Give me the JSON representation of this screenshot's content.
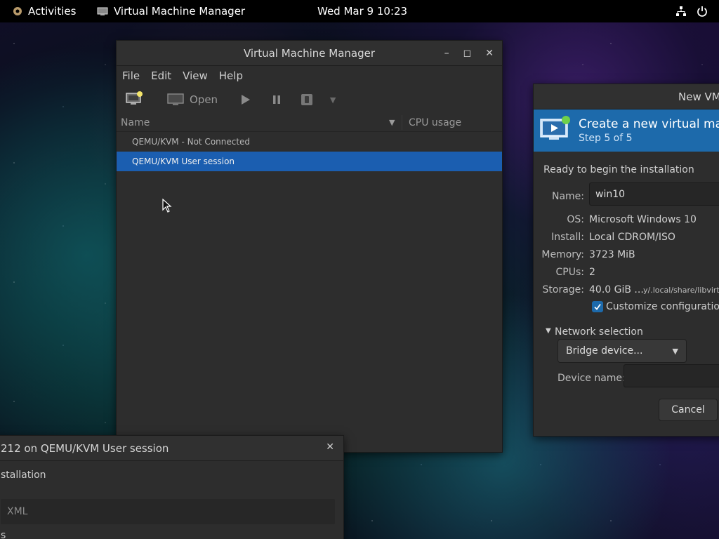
{
  "topbar": {
    "activities": "Activities",
    "app_name": "Virtual Machine Manager",
    "clock": "Wed Mar 9  10:23",
    "icons": [
      "network-icon",
      "power-icon"
    ]
  },
  "main_window": {
    "title": "Virtual Machine Manager",
    "menu": [
      "File",
      "Edit",
      "View",
      "Help"
    ],
    "toolbar": {
      "open_label": "Open"
    },
    "columns": {
      "name": "Name",
      "cpu": "CPU usage"
    },
    "rows": [
      {
        "label": "QEMU/KVM - Not Connected",
        "selected": false
      },
      {
        "label": "QEMU/KVM User session",
        "selected": true
      }
    ]
  },
  "new_vm": {
    "title": "New VM",
    "heading": "Create a new virtual mach",
    "step": "Step 5 of 5",
    "ready_text": "Ready to begin the installation",
    "name_label": "Name:",
    "name_value": "win10",
    "os_label": "OS:",
    "os_value": "Microsoft Windows 10",
    "install_label": "Install:",
    "install_value": "Local CDROM/ISO",
    "memory_label": "Memory:",
    "memory_value": "3723 MiB",
    "cpus_label": "CPUs:",
    "cpus_value": "2",
    "storage_label": "Storage:",
    "storage_value": "40.0 GiB ...",
    "storage_path": "y/.local/share/libvirt",
    "customize_label": "Customize configuration",
    "customize_checked": true,
    "network_label": "Network selection",
    "network_value": "Bridge device...",
    "device_name_label": "Device name:",
    "cancel_label": "Cancel"
  },
  "bottom_window": {
    "title": "212 on QEMU/KVM User session",
    "line1": "stallation",
    "tab_xml": "XML",
    "line3": "s"
  }
}
